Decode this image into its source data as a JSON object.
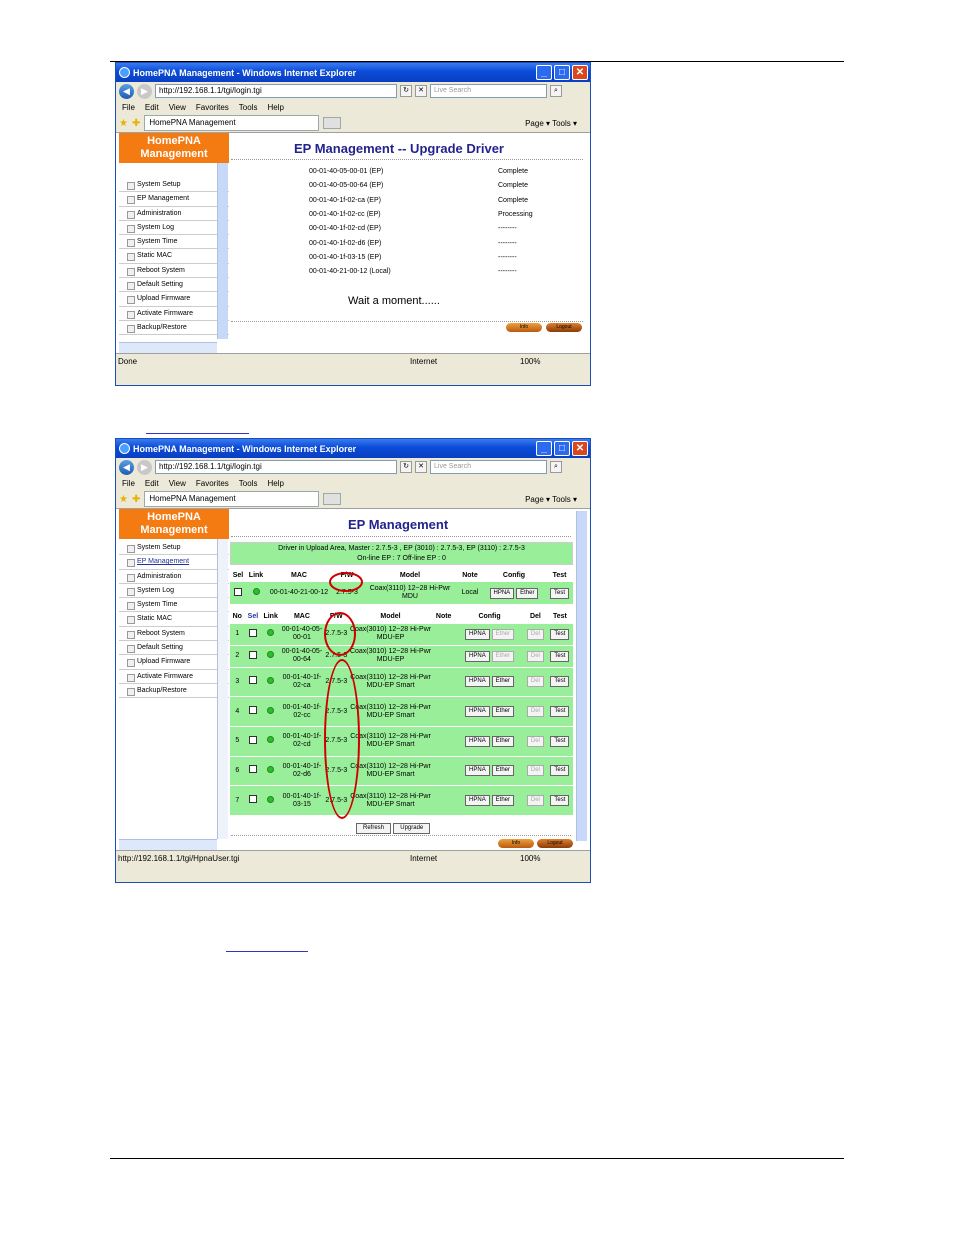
{
  "shot1": {
    "window_title": "HomePNA Management - Windows Internet Explorer",
    "url": "http://192.168.1.1/tgi/login.tgi",
    "search_placeholder": "Live Search",
    "menu": [
      "File",
      "Edit",
      "View",
      "Favorites",
      "Tools",
      "Help"
    ],
    "tab_title": "HomePNA Management",
    "toolbar_right": "Page ▾ Tools ▾",
    "logo_line1": "HomePNA",
    "logo_line2": "Management",
    "sidebar": [
      "System Setup",
      "EP Management",
      "Administration",
      "System Log",
      "System Time",
      "Static MAC",
      "Reboot System",
      "Default Setting",
      "Upload Firmware",
      "Activate Firmware",
      "Backup/Restore"
    ],
    "heading": "EP Management -- Upgrade Driver",
    "rows": [
      {
        "mac": "00-01-40-05-00-01 (EP)",
        "status": "Complete"
      },
      {
        "mac": "00-01-40-05-00-64 (EP)",
        "status": "Complete"
      },
      {
        "mac": "00-01-40-1f-02-ca (EP)",
        "status": "Complete"
      },
      {
        "mac": "00-01-40-1f-02-cc (EP)",
        "status": "Processing"
      },
      {
        "mac": "00-01-40-1f-02-cd (EP)",
        "status": "--------"
      },
      {
        "mac": "00-01-40-1f-02-d6 (EP)",
        "status": "--------"
      },
      {
        "mac": "00-01-40-1f-03-15 (EP)",
        "status": "--------"
      },
      {
        "mac": "00-01-40-21-00-12 (Local)",
        "status": "--------"
      }
    ],
    "wait": "Wait a moment......",
    "info": "Info",
    "logout": "Logout",
    "status_left": "Done",
    "zone": "Internet",
    "zoom": "100%"
  },
  "shot2": {
    "window_title": "HomePNA Management - Windows Internet Explorer",
    "url": "http://192.168.1.1/tgi/login.tgi",
    "search_placeholder": "Live Search",
    "menu": [
      "File",
      "Edit",
      "View",
      "Favorites",
      "Tools",
      "Help"
    ],
    "tab_title": "HomePNA Management",
    "toolbar_right": "Page ▾ Tools ▾",
    "logo_line1": "HomePNA",
    "logo_line2": "Management",
    "sidebar": [
      "System Setup",
      "EP Management",
      "Administration",
      "System Log",
      "System Time",
      "Static MAC",
      "Reboot System",
      "Default Setting",
      "Upload Firmware",
      "Activate Firmware",
      "Backup/Restore"
    ],
    "heading": "EP Management",
    "driver_line1": "Driver in Upload Area, Master : 2.7.5-3 ,   EP (3010) : 2.7.5-3,   EP (3110) : 2.7.5-3",
    "driver_line2": "On-line EP : 7    Off-line EP : 0",
    "master_headers": [
      "Sel",
      "Link",
      "MAC",
      "F/W",
      "Model",
      "Note",
      "Config",
      "Test"
    ],
    "master_row": {
      "mac": "00-01-40-21-00-12",
      "fw": "2.7.5-3",
      "model": "Coax(3110) 12~28 Hi-Pwr MDU",
      "note": "Local",
      "hpna": "HPNA",
      "ether": "Ether",
      "test": "Test"
    },
    "ep_headers": [
      "No",
      "Sel",
      "Link",
      "MAC",
      "F/W",
      "Model",
      "Note",
      "Config",
      "Del",
      "Test"
    ],
    "ep_rows": [
      {
        "no": "1",
        "mac": "00-01-40-05-00-01",
        "fw": "2.7.5-3",
        "model": "Coax(3010) 12~28 Hi-Pwr MDU-EP"
      },
      {
        "no": "2",
        "mac": "00-01-40-05-00-64",
        "fw": "2.7.5-3",
        "model": "Coax(3010) 12~28 Hi-Pwr MDU-EP"
      },
      {
        "no": "3",
        "mac": "00-01-40-1f-02-ca",
        "fw": "2.7.5-3",
        "model": "Coax(3110) 12~28 Hi-Pwr MDU-EP Smart"
      },
      {
        "no": "4",
        "mac": "00-01-40-1f-02-cc",
        "fw": "2.7.5-3",
        "model": "Coax(3110) 12~28 Hi-Pwr MDU-EP Smart"
      },
      {
        "no": "5",
        "mac": "00-01-40-1f-02-cd",
        "fw": "2.7.5-3",
        "model": "Coax(3110) 12~28 Hi-Pwr MDU-EP Smart"
      },
      {
        "no": "6",
        "mac": "00-01-40-1f-02-d6",
        "fw": "2.7.5-3",
        "model": "Coax(3110) 12~28 Hi-Pwr MDU-EP Smart"
      },
      {
        "no": "7",
        "mac": "00-01-40-1f-03-15",
        "fw": "2.7.5-3",
        "model": "Coax(3110) 12~28 Hi-Pwr MDU-EP Smart"
      }
    ],
    "btn_hpna": "HPNA",
    "btn_ether": "Ether",
    "btn_del": "Del",
    "btn_test": "Test",
    "refresh": "Refresh",
    "upgrade": "Upgrade",
    "info": "Info",
    "logout": "Logout",
    "status_left": "http://192.168.1.1/tgi/HpnaUser.tgi",
    "zone": "Internet",
    "zoom": "100%"
  }
}
